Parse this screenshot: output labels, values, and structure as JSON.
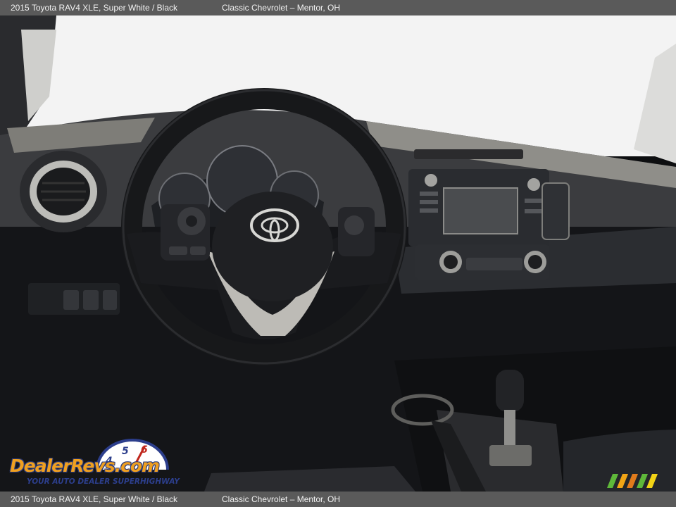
{
  "header": {
    "vehicle": "2015 Toyota RAV4 XLE,  Super White / Black",
    "dealer": "Classic Chevrolet – Mentor, OH"
  },
  "footer": {
    "vehicle": "2015 Toyota RAV4 XLE,  Super White / Black",
    "dealer": "Classic Chevrolet – Mentor, OH"
  },
  "photo": {
    "subject": "dashboard-steering-wheel",
    "colors": {
      "windshield": "#f4f4f4",
      "dash": "#1c1e22",
      "trim": "#9a9a96"
    }
  },
  "watermark": {
    "logo_text": "DealerRevs.com",
    "gauge_digits": [
      "4",
      "5",
      "6"
    ],
    "tagline": "YOUR AUTO DEALER SUPERHIGHWAY",
    "colors": {
      "orange": "#f0a020",
      "navy": "#2c3e8c"
    }
  },
  "badge": {
    "colors": [
      "#5fb83a",
      "#f2a516",
      "#e07b1c",
      "#5fb83a",
      "#f2d316"
    ]
  }
}
